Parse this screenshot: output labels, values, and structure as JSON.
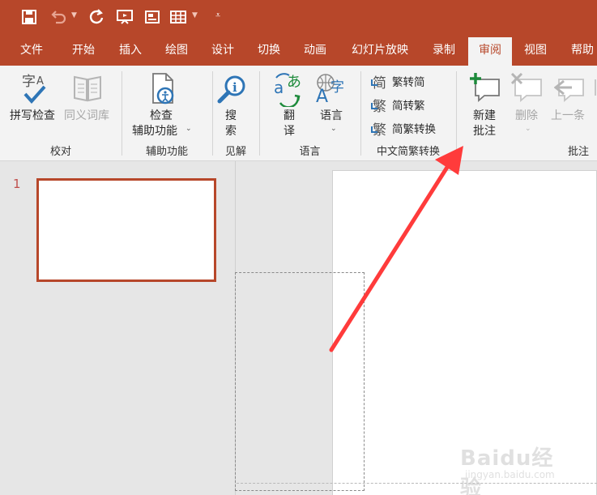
{
  "tabs": [
    "文件",
    "开始",
    "插入",
    "绘图",
    "设计",
    "切换",
    "动画",
    "幻灯片放映",
    "录制",
    "审阅",
    "视图",
    "帮助"
  ],
  "active_tab": "审阅",
  "ribbon": {
    "proofing": {
      "spell_check": "拼写检查",
      "thesaurus": "同义词库",
      "group": "校对"
    },
    "accessibility": {
      "check_line1": "检查",
      "check_line2": "辅助功能",
      "group": "辅助功能"
    },
    "insights": {
      "search_line1": "搜",
      "search_line2": "索",
      "group": "见解"
    },
    "language": {
      "translate_line1": "翻",
      "translate_line2": "译",
      "language": "语言",
      "group": "语言"
    },
    "chinese_conversion": {
      "to_traditional": "繁转简",
      "to_simplified": "简转繁",
      "convert": "简繁转换",
      "group": "中文简繁转换"
    },
    "comments": {
      "new_line1": "新建",
      "new_line2": "批注",
      "delete": "删除",
      "previous": "上一条",
      "group": "批注"
    }
  },
  "slides": [
    {
      "number": "1"
    }
  ],
  "watermark": {
    "brand": "Baidu经验",
    "url": "jingyan.baidu.com"
  },
  "colors": {
    "accent": "#b7472a",
    "annotation_arrow": "#ff3b3b",
    "ribbon_bg": "#f3f3f3"
  }
}
